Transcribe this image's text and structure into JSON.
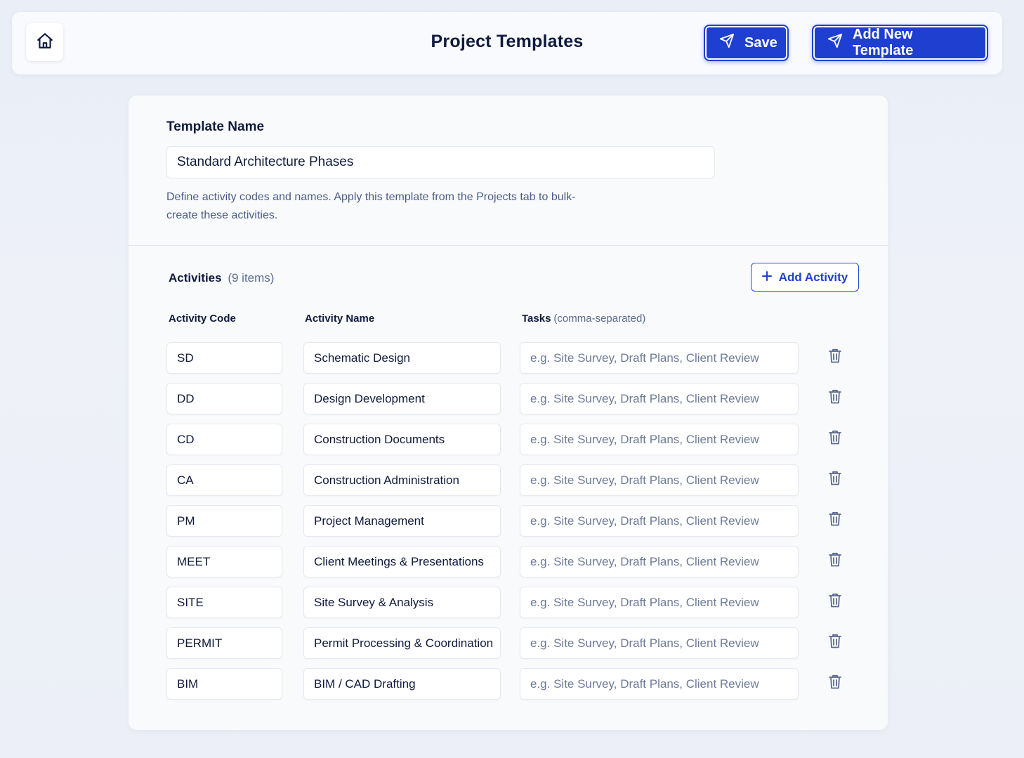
{
  "header": {
    "title": "Project Templates",
    "save_label": "Save",
    "add_template_label": "Add New Template"
  },
  "template": {
    "label": "Template Name",
    "name_value": "Standard Architecture Phases",
    "helper_text": "Define activity codes and names. Apply this template from the Projects tab to bulk-create these activities."
  },
  "activities": {
    "title": "Activities",
    "count": "(9 items)",
    "add_label": "Add Activity",
    "columns": {
      "code": "Activity Code",
      "name": "Activity Name",
      "tasks": "Tasks",
      "tasks_hint": "(comma-separated)"
    },
    "tasks_placeholder": "e.g. Site Survey, Draft Plans, Client Review",
    "rows": [
      {
        "code": "SD",
        "name": "Schematic Design"
      },
      {
        "code": "DD",
        "name": "Design Development"
      },
      {
        "code": "CD",
        "name": "Construction Documents"
      },
      {
        "code": "CA",
        "name": "Construction Administration"
      },
      {
        "code": "PM",
        "name": "Project Management"
      },
      {
        "code": "MEET",
        "name": "Client Meetings & Presentations"
      },
      {
        "code": "SITE",
        "name": "Site Survey & Analysis"
      },
      {
        "code": "PERMIT",
        "name": "Permit Processing & Coordination"
      },
      {
        "code": "BIM",
        "name": "BIM / CAD Drafting"
      }
    ]
  },
  "icons": {
    "home": "home-icon",
    "send": "send-icon",
    "plus": "plus-icon",
    "trash": "trash-icon"
  },
  "colors": {
    "accent": "#1f3fd1",
    "background": "#eceff7",
    "text": "#0f1b3d",
    "muted": "#5b6b8f"
  }
}
